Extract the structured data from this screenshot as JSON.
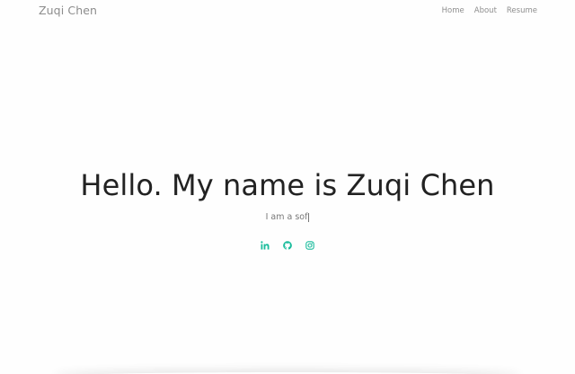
{
  "brand": {
    "name": "Zuqi Chen"
  },
  "nav": {
    "items": [
      {
        "label": "Home"
      },
      {
        "label": "About"
      },
      {
        "label": "Resume"
      }
    ]
  },
  "hero": {
    "title": "Hello. My name is Zuqi Chen",
    "typed_text": "I am a sof"
  },
  "socials": [
    {
      "icon": "linkedin-icon",
      "color": "#1abc9c"
    },
    {
      "icon": "github-icon",
      "color": "#1abc9c"
    },
    {
      "icon": "instagram-icon",
      "color": "#1abc9c"
    }
  ],
  "colors": {
    "accent": "#1abc9c",
    "title": "#222222",
    "muted": "#8c8c8c"
  }
}
